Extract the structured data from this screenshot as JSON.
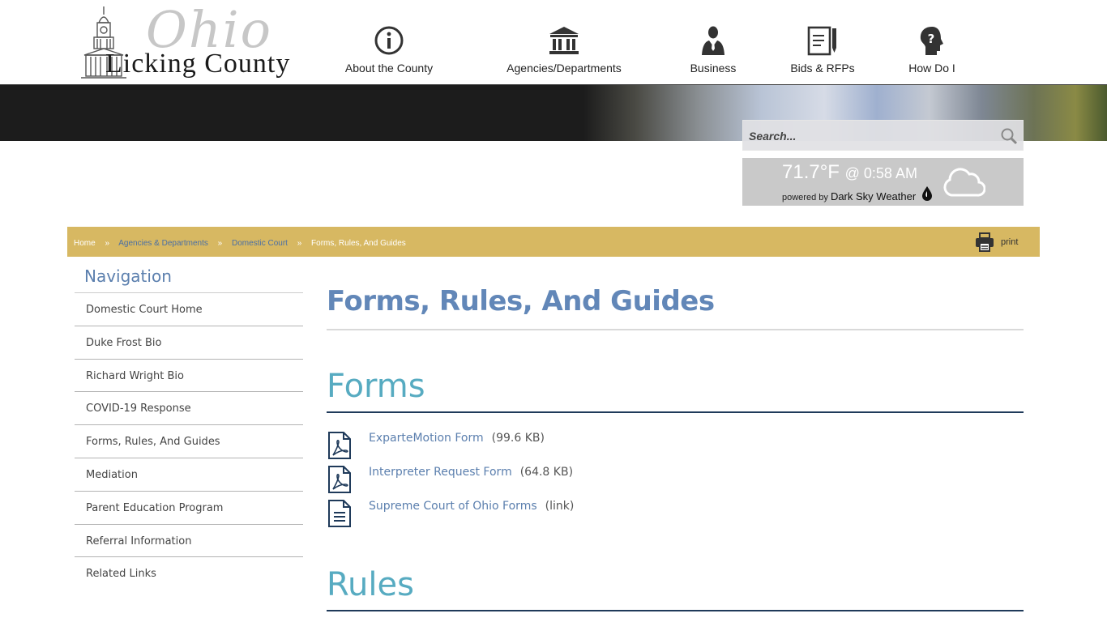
{
  "header": {
    "logo": {
      "word_ohio": "Ohio",
      "word_county": "Licking County"
    },
    "nav": [
      {
        "label": "About the County",
        "icon": "info-icon"
      },
      {
        "label": "Agencies/Departments",
        "icon": "government-building-icon"
      },
      {
        "label": "Business",
        "icon": "businessman-icon"
      },
      {
        "label": "Bids & RFPs",
        "icon": "document-pen-icon"
      },
      {
        "label": "How Do I",
        "icon": "question-head-icon"
      }
    ]
  },
  "search": {
    "placeholder": "Search..."
  },
  "weather": {
    "temp": "71.7°F",
    "time": "@ 0:58 AM",
    "powered_prefix": "powered by",
    "powered_name": "Dark Sky Weather",
    "icon": "cloud-icon"
  },
  "breadcrumb": {
    "home": "Home",
    "agencies": "Agencies & Departments",
    "domestic": "Domestic Court",
    "current": "Forms, Rules, And Guides",
    "separator": "»",
    "print": "print",
    "colors": {
      "bar": "#d7b862",
      "link": "#4a6fa5"
    }
  },
  "sidebar": {
    "title": "Navigation",
    "items": [
      "Domestic Court Home",
      "Duke Frost Bio",
      "Richard Wright Bio",
      "COVID-19 Response",
      "Forms, Rules, And Guides",
      "Mediation",
      "Parent Education Program",
      "Referral Information",
      "Related Links"
    ]
  },
  "main": {
    "title": "Forms, Rules, And Guides",
    "forms_heading": "Forms",
    "rules_heading": "Rules",
    "forms": [
      {
        "name": "ExparteMotion Form",
        "meta": "(99.6 KB)",
        "icon": "pdf-icon"
      },
      {
        "name": "Interpreter Request Form",
        "meta": "(64.8 KB)",
        "icon": "pdf-icon"
      },
      {
        "name": "Supreme Court of Ohio Forms",
        "meta": "(link)",
        "icon": "document-icon"
      }
    ]
  }
}
